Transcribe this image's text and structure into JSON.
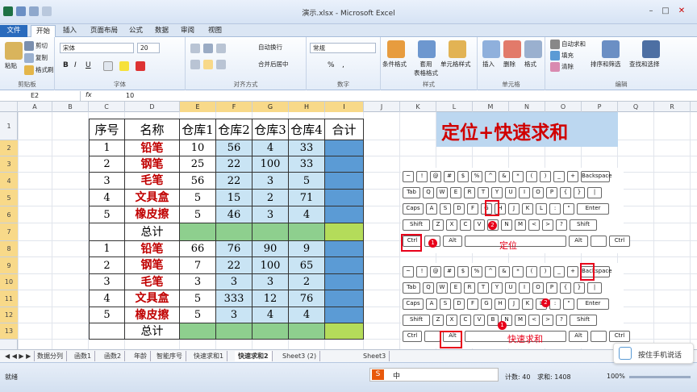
{
  "window": {
    "title": "演示.xlsx - Microsoft Excel"
  },
  "tabs": [
    "文件",
    "开始",
    "插入",
    "页面布局",
    "公式",
    "数据",
    "审阅",
    "视图"
  ],
  "ribbon": {
    "clipboard": {
      "paste": "粘贴",
      "cut": "剪切",
      "copy": "复制",
      "format_painter": "格式刷",
      "label": "剪贴板"
    },
    "font": {
      "name": "宋体",
      "size": "20",
      "label": "字体",
      "bold": "B",
      "italic": "I",
      "underline": "U"
    },
    "alignment": {
      "wrap": "自动换行",
      "merge": "合并后居中",
      "label": "对齐方式"
    },
    "number": {
      "format": "常规",
      "label": "数字",
      "percent": "%",
      "comma": ","
    },
    "styles": {
      "conditional": "条件格式",
      "table": "套用\n表格格式",
      "cell": "单元格样式",
      "label": "样式"
    },
    "cells": {
      "insert": "插入",
      "delete": "删除",
      "format": "格式",
      "label": "单元格"
    },
    "editing": {
      "autosum": "自动求和",
      "fill": "填充",
      "clear": "清除",
      "sort": "排序和筛选",
      "find": "查找和选择",
      "label": "编辑"
    }
  },
  "formula_bar": {
    "name_box": "E2",
    "fx": "fx",
    "value": "10"
  },
  "columns": [
    "A",
    "B",
    "C",
    "D",
    "E",
    "F",
    "G",
    "H",
    "I",
    "J",
    "K",
    "L",
    "M",
    "N",
    "O",
    "P",
    "Q",
    "R"
  ],
  "rows": [
    "1",
    "2",
    "3",
    "4",
    "5",
    "6",
    "7",
    "8",
    "9",
    "10",
    "11",
    "12",
    "13"
  ],
  "table": {
    "headers": [
      "序号",
      "名称",
      "仓库1",
      "仓库2",
      "仓库3",
      "仓库4",
      "合计"
    ],
    "block1": [
      [
        "1",
        "铅笔",
        "10",
        "56",
        "4",
        "33"
      ],
      [
        "2",
        "钢笔",
        "25",
        "22",
        "100",
        "33"
      ],
      [
        "3",
        "毛笔",
        "56",
        "22",
        "3",
        "5"
      ],
      [
        "4",
        "文具盒",
        "5",
        "15",
        "2",
        "71"
      ],
      [
        "5",
        "橡皮擦",
        "5",
        "46",
        "3",
        "4"
      ]
    ],
    "total1": "总计",
    "block2": [
      [
        "1",
        "铅笔",
        "66",
        "76",
        "90",
        "9"
      ],
      [
        "2",
        "钢笔",
        "7",
        "22",
        "100",
        "65"
      ],
      [
        "3",
        "毛笔",
        "3",
        "3",
        "3",
        "2"
      ],
      [
        "4",
        "文具盒",
        "5",
        "333",
        "12",
        "76"
      ],
      [
        "5",
        "橡皮擦",
        "5",
        "3",
        "4",
        "4"
      ]
    ],
    "total2": "总计"
  },
  "banner": "定位+快速求和",
  "keyboard1": {
    "label": "定位",
    "ctrl": "Ctrl",
    "key": "G",
    "n1": "1",
    "n2": "2"
  },
  "keyboard2": {
    "label": "快速求和",
    "alt": "Alt",
    "key": "=",
    "n1": "1",
    "n2": "2"
  },
  "sheet_tabs": [
    "数据分列",
    "函数1",
    "函数2",
    "年龄",
    "智能序号",
    "快速求和1",
    "快速求和2",
    "Sheet3 (2)",
    "Sheet3"
  ],
  "active_sheet": "快速求和2",
  "status": {
    "mode": "就绪",
    "count": "计数: 40",
    "sum": "求和: 1408",
    "zoom": "100%"
  },
  "phone_button": "按住手机说话",
  "colors": {
    "accent": "#2a6bbd",
    "red": "#e8001a",
    "blue_cell": "#c9e4f4",
    "green_cell": "#8ecf8e",
    "dark_blue": "#5b9bd5",
    "lime": "#b4dc5a"
  }
}
